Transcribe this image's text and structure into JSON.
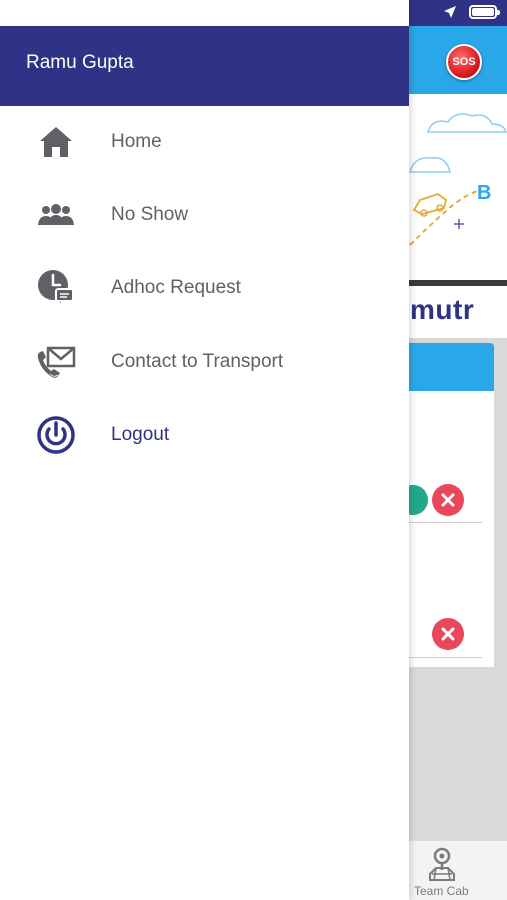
{
  "drawer": {
    "user_name": "Ramu Gupta",
    "items": [
      {
        "label": "Home",
        "icon": "home-icon"
      },
      {
        "label": "No Show",
        "icon": "group-icon"
      },
      {
        "label": "Adhoc Request",
        "icon": "clock-message-icon"
      },
      {
        "label": "Contact to Transport",
        "icon": "phone-mail-icon"
      },
      {
        "label": "Logout",
        "icon": "power-icon"
      }
    ]
  },
  "background": {
    "sos_label": "SOS",
    "brand_partial": "mutr",
    "illustration_letter": "B",
    "bottom_tab_label": "Team Cab"
  },
  "colors": {
    "drawer_header": "#2f3285",
    "app_accent": "#2aa7e8",
    "menu_text": "#606166",
    "logout_text": "#2f3285",
    "reject": "#e8495a",
    "accept": "#20a88c"
  }
}
